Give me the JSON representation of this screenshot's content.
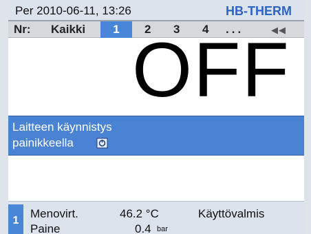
{
  "header": {
    "datetime": "Per 2010-06-11, 13:26",
    "brand": "HB-THERM"
  },
  "tabbar": {
    "nr_label": "Nr:",
    "all_label": "Kaikki",
    "tabs": [
      "1",
      "2",
      "3",
      "4"
    ],
    "more": "...",
    "nav_icons": [
      "previous-icon",
      "next-icon"
    ]
  },
  "main": {
    "state_text": "OFF",
    "message_line1": "Laitteen käynnistys",
    "message_line2": "painikkeella",
    "message_icon": "power-button-icon"
  },
  "status": {
    "index": "1",
    "flow_label": "Menovirt.",
    "flow_value": "46.2 °C",
    "pressure_label": "Paine",
    "pressure_value": "0.4",
    "pressure_unit": "bar",
    "ready": "Käyttövalmis"
  },
  "colors": {
    "accent_blue": "#4a86d8",
    "brand_blue": "#2b64c4",
    "header_bg": "#dce3ec"
  }
}
